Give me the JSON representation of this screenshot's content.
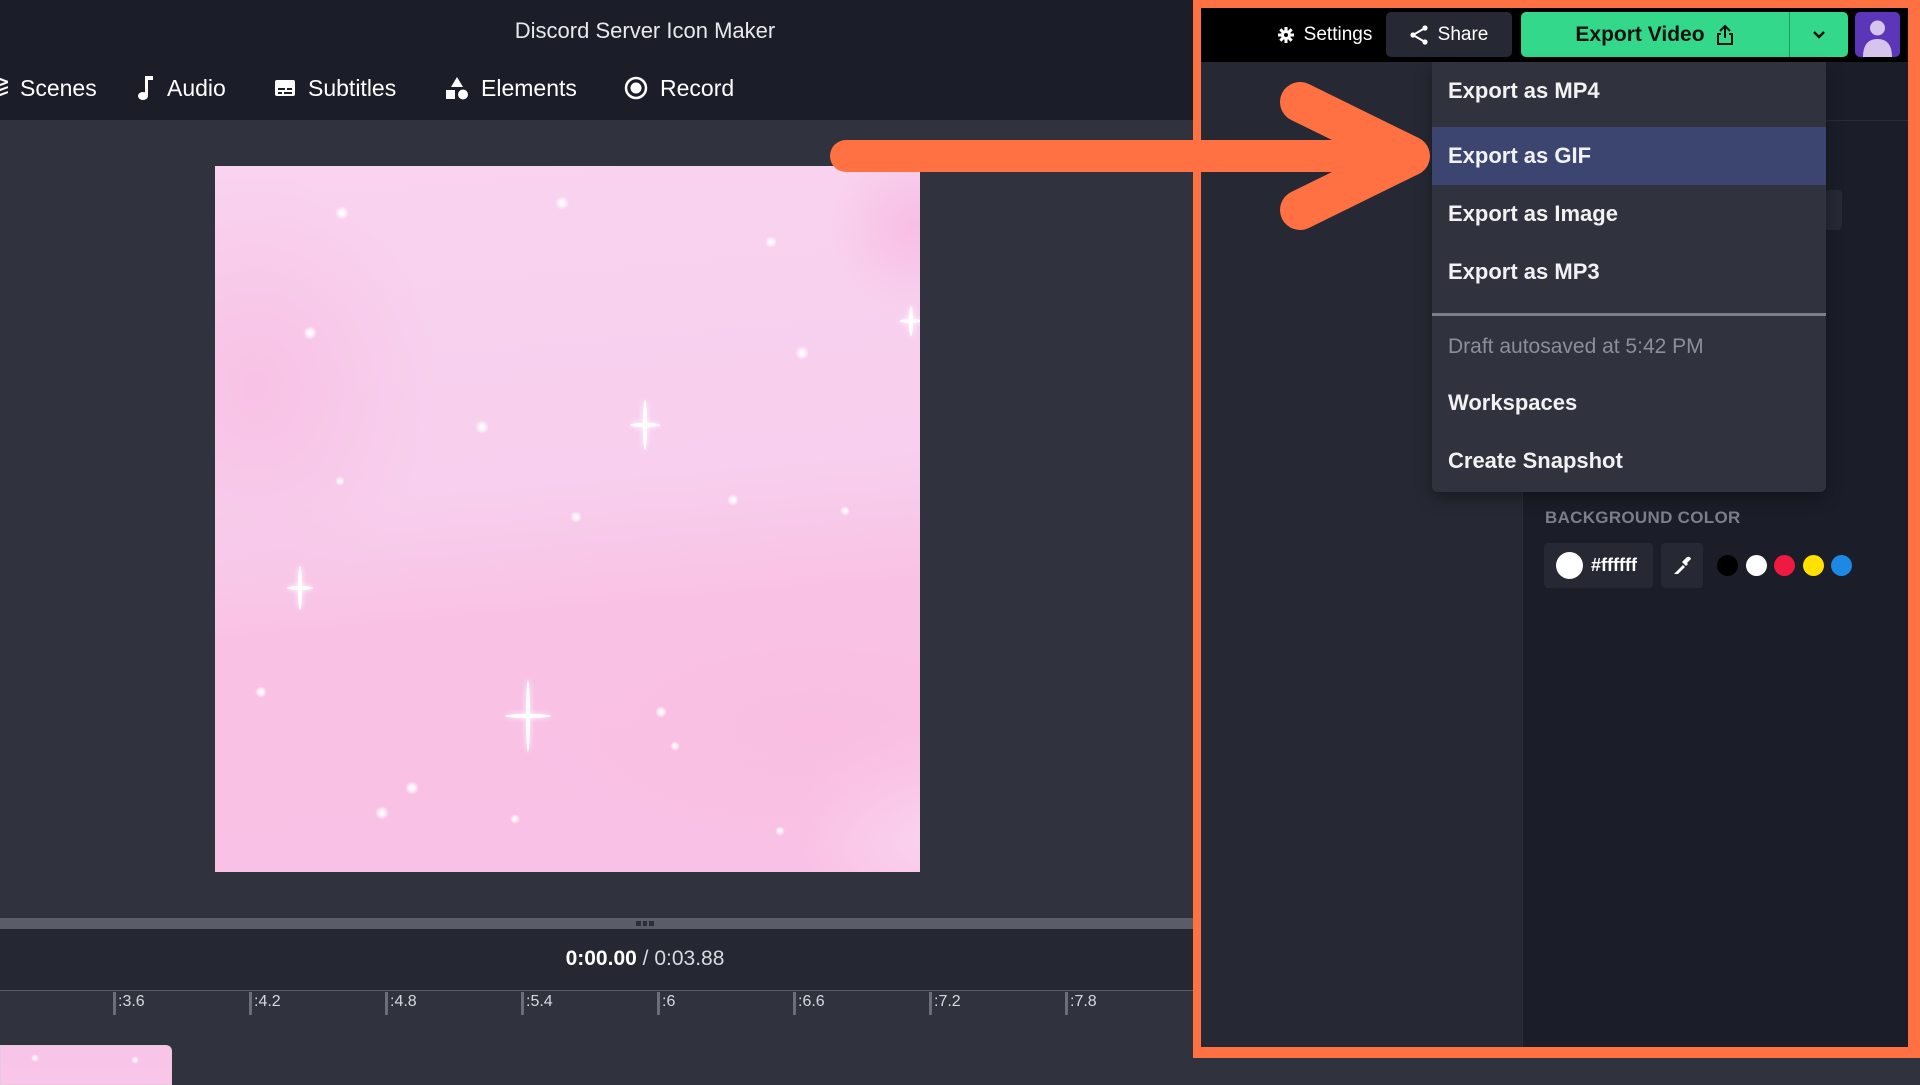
{
  "app": {
    "title": "Discord Server Icon Maker"
  },
  "nav": {
    "items": [
      {
        "label": "Scenes",
        "icon": "layers-icon"
      },
      {
        "label": "Audio",
        "icon": "music-note-icon"
      },
      {
        "label": "Subtitles",
        "icon": "subtitles-icon"
      },
      {
        "label": "Elements",
        "icon": "shapes-icon"
      },
      {
        "label": "Record",
        "icon": "record-icon"
      }
    ]
  },
  "header": {
    "settings_label": "Settings",
    "share_label": "Share",
    "export_label": "Export Video"
  },
  "export_menu": {
    "items": [
      {
        "label": "Export as MP4",
        "active": false
      },
      {
        "label": "Export as GIF",
        "active": true
      },
      {
        "label": "Export as Image",
        "active": false
      },
      {
        "label": "Export as MP3",
        "active": false
      }
    ],
    "draft_status": "Draft autosaved at 5:42 PM",
    "workspaces_label": "Workspaces",
    "snapshot_label": "Create Snapshot"
  },
  "background": {
    "label": "BACKGROUND COLOR",
    "hex": "#ffffff",
    "swatches": [
      "#000000",
      "#ffffff",
      "#f0193f",
      "#ffe100",
      "#1e88e5"
    ]
  },
  "player": {
    "current_time": "0:00.00",
    "separator": " / ",
    "total_time": "0:03.88"
  },
  "timeline": {
    "ticks": [
      ":3.6",
      ":4.2",
      ":4.8",
      ":5.4",
      ":6",
      ":6.6",
      ":7.2",
      ":7.8"
    ]
  },
  "colors": {
    "accent_export": "#34d88a",
    "annotation": "#ff7043",
    "menu_highlight": "#3b456f"
  }
}
